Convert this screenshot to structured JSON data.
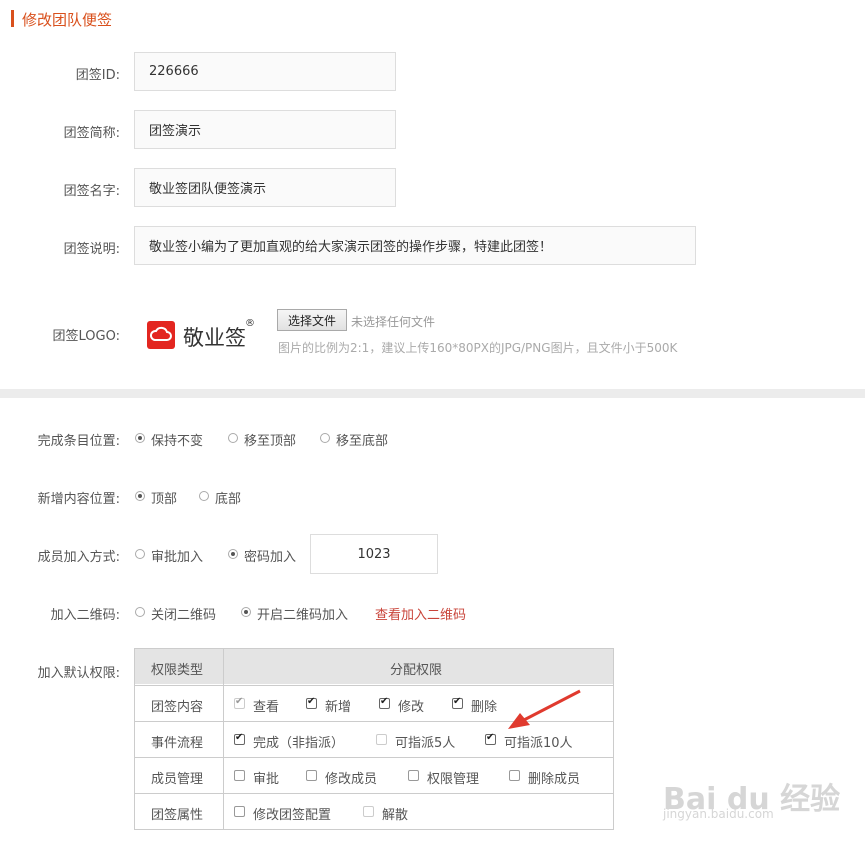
{
  "page_title": "修改团队便签",
  "form": {
    "id": {
      "label": "团签ID:",
      "value": "226666"
    },
    "short_name": {
      "label": "团签简称:",
      "value": "团签演示"
    },
    "name": {
      "label": "团签名字:",
      "value": "敬业签团队便签演示"
    },
    "desc": {
      "label": "团签说明:",
      "value": "敬业签小编为了更加直观的给大家演示团签的操作步骤，特建此团签！"
    },
    "logo": {
      "label": "团签LOGO:",
      "logo_text": "敬业签",
      "logo_mark": "®",
      "file_button": "选择文件",
      "file_status": "未选择任何文件",
      "hint": "图片的比例为2:1，建议上传160*80PX的JPG/PNG图片，且文件小于500K"
    }
  },
  "settings": {
    "done_position": {
      "label": "完成条目位置:",
      "options": [
        "保持不变",
        "移至顶部",
        "移至底部"
      ],
      "selected": 0
    },
    "new_position": {
      "label": "新增内容位置:",
      "options": [
        "顶部",
        "底部"
      ],
      "selected": 0
    },
    "join_method": {
      "label": "成员加入方式:",
      "options": [
        "审批加入",
        "密码加入"
      ],
      "selected": 1,
      "password": "1023"
    },
    "qr_code": {
      "label": "加入二维码:",
      "options": [
        "关闭二维码",
        "开启二维码加入"
      ],
      "selected": 1,
      "link": "查看加入二维码"
    },
    "permissions": {
      "label": "加入默认权限:",
      "headers": [
        "权限类型",
        "分配权限"
      ],
      "rows": [
        {
          "name": "团签内容",
          "items": [
            {
              "label": "查看",
              "checked": true,
              "disabled": true
            },
            {
              "label": "新增",
              "checked": true
            },
            {
              "label": "修改",
              "checked": true
            },
            {
              "label": "删除",
              "checked": true
            }
          ]
        },
        {
          "name": "事件流程",
          "items": [
            {
              "label": "完成（非指派）",
              "checked": true
            },
            {
              "label": "可指派5人",
              "checked": false,
              "disabled": true
            },
            {
              "label": "可指派10人",
              "checked": true
            }
          ]
        },
        {
          "name": "成员管理",
          "items": [
            {
              "label": "审批",
              "checked": false
            },
            {
              "label": "修改成员",
              "checked": false
            },
            {
              "label": "权限管理",
              "checked": false
            },
            {
              "label": "删除成员",
              "checked": false
            }
          ]
        },
        {
          "name": "团签属性",
          "items": [
            {
              "label": "修改团签配置",
              "checked": false
            },
            {
              "label": "解散",
              "checked": false,
              "disabled": true
            }
          ]
        }
      ]
    }
  },
  "watermark": {
    "main": "Bai du 经验",
    "sub": "jingyan.baidu.com"
  },
  "colors": {
    "accent": "#d9501c",
    "link": "#c9443a",
    "logo_red": "#e32620"
  }
}
